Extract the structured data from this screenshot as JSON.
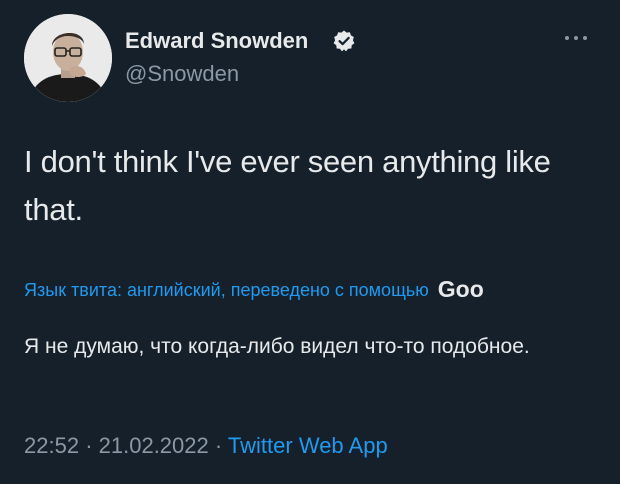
{
  "author": {
    "display_name": "Edward Snowden",
    "handle": "@Snowden"
  },
  "tweet": {
    "text": "I don't think I've ever seen anything like that."
  },
  "translation": {
    "notice": "Язык твита: английский, переведено с помощью",
    "provider": "Goo",
    "text": "Я не думаю, что когда-либо видел что-то подобное."
  },
  "meta": {
    "time": "22:52",
    "separator": "·",
    "date": "21.02.2022",
    "app": "Twitter Web App"
  },
  "icons": {
    "verified": "verified-badge-icon",
    "more": "more-options-icon"
  },
  "colors": {
    "background": "#15202b",
    "text": "#e7e9ea",
    "secondary": "#8b98a5",
    "accent": "#1d9bf0"
  }
}
